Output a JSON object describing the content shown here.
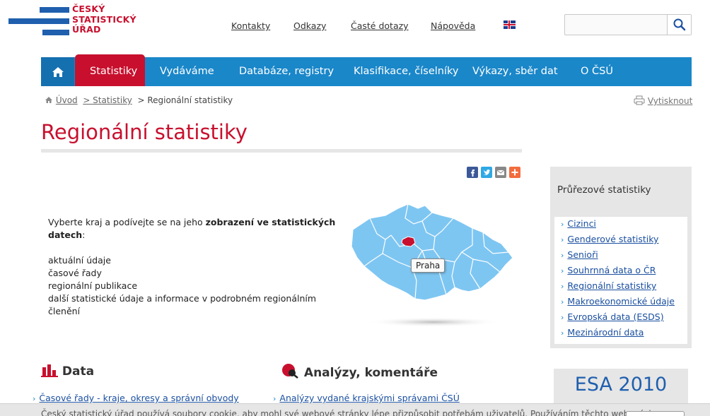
{
  "logo": {
    "lines": [
      "ČESKÝ",
      "STATISTICKÝ",
      "ÚŘAD"
    ]
  },
  "top_links": [
    "Kontakty",
    "Odkazy",
    "Časté dotazy",
    "Nápověda"
  ],
  "search": {
    "placeholder": ""
  },
  "nav": {
    "items": [
      "Statistiky",
      "Vydáváme",
      "Databáze, registry",
      "Klasifikace, číselníky",
      "Výkazy, sběr dat",
      "O ČSÚ"
    ]
  },
  "breadcrumb": {
    "home": "Úvod",
    "level1": "> Statistiky",
    "current": "> Regionální statistiky"
  },
  "print_label": "Vytisknout",
  "page_title": "Regionální statistiky",
  "intro": {
    "lead": "Vyberte kraj a podívejte se na jeho ",
    "lead_bold": "zobrazení ve statistických datech",
    "lead_end": ":",
    "items": [
      "aktuální údaje",
      "časové řady",
      "regionální publikace",
      "další statistické údaje a informace v podrobném regionálním členění"
    ]
  },
  "map": {
    "tooltip": "Praha",
    "region_color": "#7ec6f2",
    "selected_color": "#c8102e"
  },
  "sidebar": {
    "title": "Průřezové statistiky",
    "links": [
      "Cizinci",
      "Genderové statistiky",
      "Senioři",
      "Souhrnná data o ČR",
      "Regionální statistiky",
      "Makroekonomické údaje",
      "Evropská data (ESDS)",
      "Mezinárodní data"
    ]
  },
  "sections": {
    "data": {
      "title": "Data",
      "first_link": "Časové řady - kraje, okresy a správní obvody"
    },
    "analyzy": {
      "title": "Analýzy, komentáře",
      "first_link": "Analýzy vydané krajskými správami ČSÚ"
    }
  },
  "esa_banner": "ESA 2010",
  "cookie_text": "Český statistický úřad používá soubory cookie, aby mohl své webové stránky lépe přizpůsobit potřebám uživatelů. Používáním těchto webových",
  "colors": {
    "brand_red": "#c8102e",
    "brand_blue": "#1f5fae",
    "nav_blue": "#1a87c9"
  }
}
